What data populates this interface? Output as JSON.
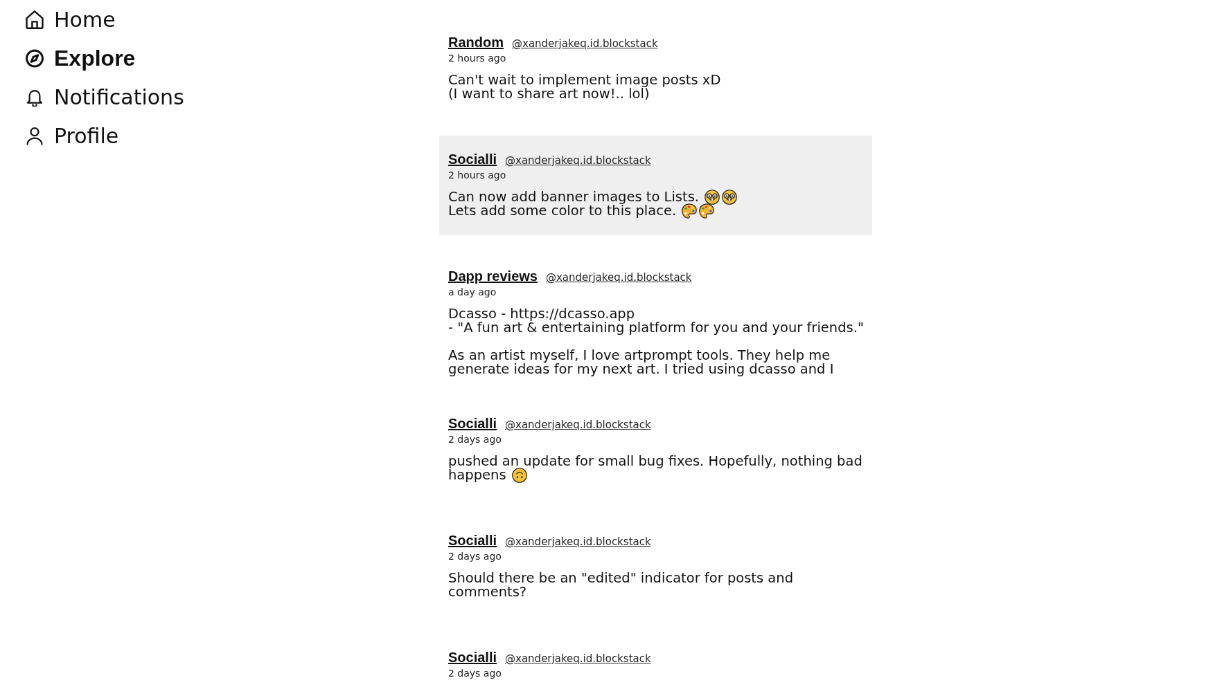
{
  "sidebar": {
    "items": [
      {
        "label": "Home",
        "selected": false
      },
      {
        "label": "Explore",
        "selected": true
      },
      {
        "label": "Notifications",
        "selected": false
      },
      {
        "label": "Profile",
        "selected": false
      }
    ]
  },
  "feed": {
    "posts": [
      {
        "author": "Random",
        "handle": "@xanderjakeq.id.blockstack",
        "time": "2 hours ago",
        "highlighted": false,
        "truncated": false,
        "paragraphs": [
          [
            {
              "text": "Can't wait to implement image posts xD"
            },
            {
              "text": "(I want to share art now!.. lol)"
            }
          ]
        ]
      },
      {
        "author": "Socialli",
        "handle": "@xanderjakeq.id.blockstack",
        "time": "2 hours ago",
        "highlighted": true,
        "truncated": false,
        "paragraphs": [
          [
            {
              "text": "Can now add banner images to Lists.",
              "emojis": [
                {
                  "kind": "nerd"
                },
                {
                  "kind": "nerd"
                }
              ]
            },
            {
              "text": "Lets add some color to this place.",
              "emojis": [
                {
                  "kind": "palette"
                },
                {
                  "kind": "palette"
                }
              ]
            }
          ]
        ]
      },
      {
        "author": "Dapp reviews",
        "handle": "@xanderjakeq.id.blockstack",
        "time": "a day ago",
        "highlighted": false,
        "truncated": true,
        "paragraphs": [
          [
            {
              "text": "Dcasso - https://dcasso.app"
            },
            {
              "text": "- \"A fun art & entertaining platform for you and your friends.\""
            }
          ],
          [
            {
              "text": "As an artist myself, I love artprompt tools. They help me"
            },
            {
              "text": "generate ideas for my next art. I tried using dcasso and I"
            }
          ]
        ]
      },
      {
        "author": "Socialli",
        "handle": "@xanderjakeq.id.blockstack",
        "time": "2 days ago",
        "highlighted": false,
        "truncated": false,
        "paragraphs": [
          [
            {
              "text": "pushed an update for small bug fixes. Hopefully, nothing bad"
            },
            {
              "text": "happens",
              "emojis": [
                {
                  "kind": "upsidedown"
                }
              ]
            }
          ]
        ]
      },
      {
        "author": "Socialli",
        "handle": "@xanderjakeq.id.blockstack",
        "time": "2 days ago",
        "highlighted": false,
        "truncated": false,
        "paragraphs": [
          [
            {
              "text": "Should there be an \"edited\" indicator for posts and"
            },
            {
              "text": "comments?"
            }
          ]
        ]
      },
      {
        "author": "Socialli",
        "handle": "@xanderjakeq.id.blockstack",
        "time": "2 days ago",
        "highlighted": false,
        "truncated": false
      }
    ]
  }
}
